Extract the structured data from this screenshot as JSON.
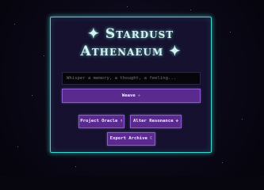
{
  "header": {
    "title_line1": "✦ Stardust",
    "title_line2": "Athenaeum ✦"
  },
  "input": {
    "placeholder": "Whisper a memory, a thought, a feeling..."
  },
  "buttons": {
    "weave": {
      "label": "Weave",
      "icon": "✧"
    },
    "project_oracle": {
      "label": "Project Oracle",
      "icon": "↑"
    },
    "alter_resonance": {
      "label": "Alter Resonance",
      "icon": "✥"
    },
    "export_archive": {
      "label": "Export Archive",
      "icon": "☾"
    }
  },
  "colors": {
    "background": "#07060f",
    "panel": "#15112e",
    "accent_glow": "#3fd6d0",
    "button": "#5b2a8e",
    "button_border": "#8d5ccd"
  }
}
